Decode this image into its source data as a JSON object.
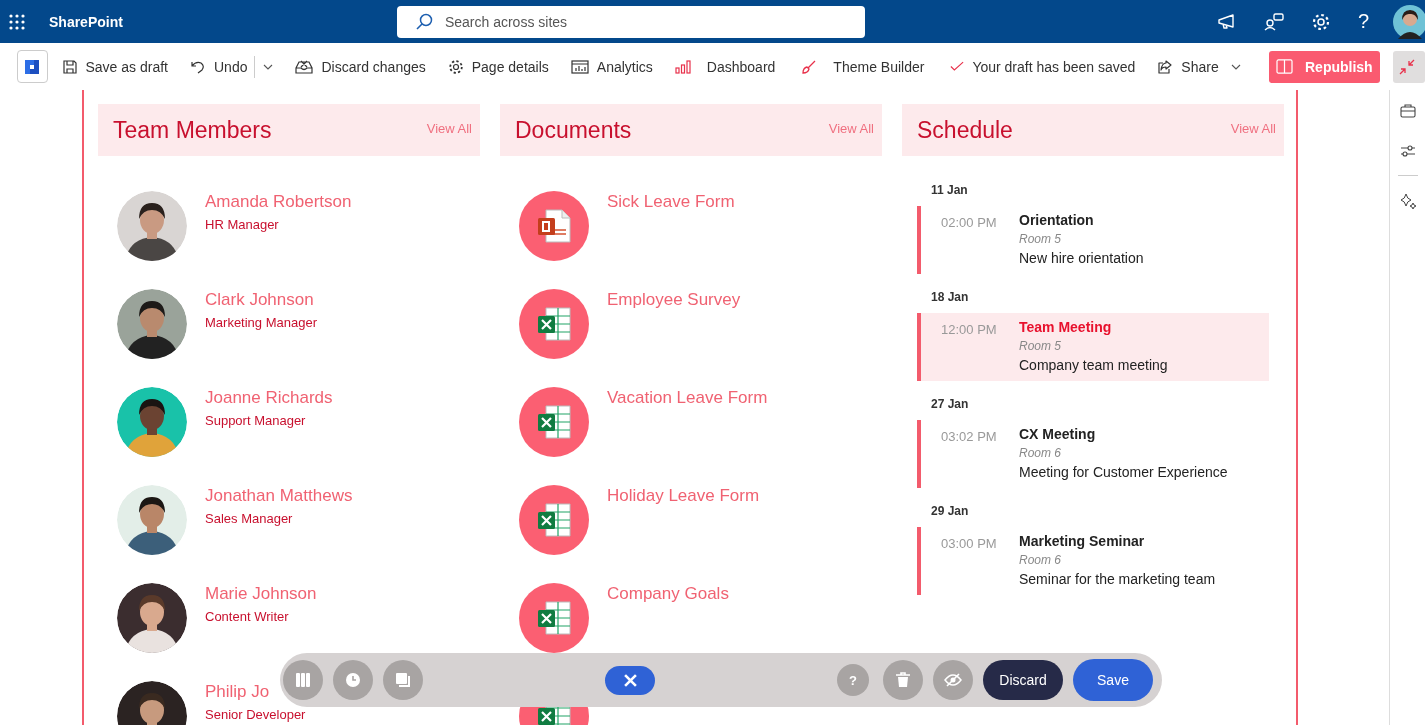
{
  "topbar": {
    "app_name": "SharePoint",
    "search": {
      "placeholder": "Search across sites"
    },
    "help": "?"
  },
  "toolbar": {
    "items": [
      {
        "kind": "save",
        "label": "Save as draft"
      },
      {
        "kind": "undo",
        "label": "Undo"
      },
      {
        "kind": "discard",
        "label": "Discard changes"
      },
      {
        "kind": "details",
        "label": "Page details"
      },
      {
        "kind": "analytics",
        "label": "Analytics"
      },
      {
        "kind": "dashboard",
        "label": "Dashboard"
      },
      {
        "kind": "theme",
        "label": "Theme Builder"
      },
      {
        "kind": "status",
        "label": "Your draft has been saved"
      },
      {
        "kind": "share",
        "label": "Share"
      }
    ],
    "primary_button": "Republish"
  },
  "team_members": {
    "title": "Team Members",
    "view_all": "View All",
    "members": [
      {
        "name": "Amanda Robertson",
        "role": "HR Manager"
      },
      {
        "name": "Clark Johnson",
        "role": "Marketing Manager"
      },
      {
        "name": "Joanne Richards",
        "role": "Support Manager"
      },
      {
        "name": "Jonathan Matthews",
        "role": "Sales Manager"
      },
      {
        "name": "Marie Johnson",
        "role": "Content Writer"
      },
      {
        "name": "Philip Jo",
        "role": "Senior Developer"
      }
    ]
  },
  "documents": {
    "title": "Documents",
    "view_all": "View All",
    "items": [
      {
        "kind": "powerpoint",
        "title": "Sick Leave Form"
      },
      {
        "kind": "excel",
        "title": "Employee Survey"
      },
      {
        "kind": "excel",
        "title": "Vacation Leave Form"
      },
      {
        "kind": "excel",
        "title": "Holiday Leave Form"
      },
      {
        "kind": "excel",
        "title": "Company Goals"
      },
      {
        "kind": "excel"
      }
    ]
  },
  "schedule": {
    "title": "Schedule",
    "view_all": "View All",
    "days": [
      {
        "date": "11 Jan",
        "events": [
          {
            "time": "02:00 PM",
            "title": "Orientation",
            "room": "Room 5",
            "description": "New hire orientation",
            "selected": false
          }
        ]
      },
      {
        "date": "18 Jan",
        "events": [
          {
            "time": "12:00 PM",
            "title": "Team Meeting",
            "room": "Room 5",
            "description": "Company team meeting",
            "selected": true
          }
        ]
      },
      {
        "date": "27 Jan",
        "events": [
          {
            "time": "03:02 PM",
            "title": "CX Meeting",
            "room": "Room 6",
            "description": "Meeting for Customer Experience",
            "selected": false
          }
        ]
      },
      {
        "date": "29 Jan",
        "events": [
          {
            "time": "03:00 PM",
            "title": "Marketing Seminar",
            "room": "Room 6",
            "description": "Seminar for the marketing team",
            "selected": false
          }
        ]
      }
    ]
  },
  "editor_bar": {
    "help": "?",
    "discard_button": "Discard",
    "save_button": "Save"
  }
}
